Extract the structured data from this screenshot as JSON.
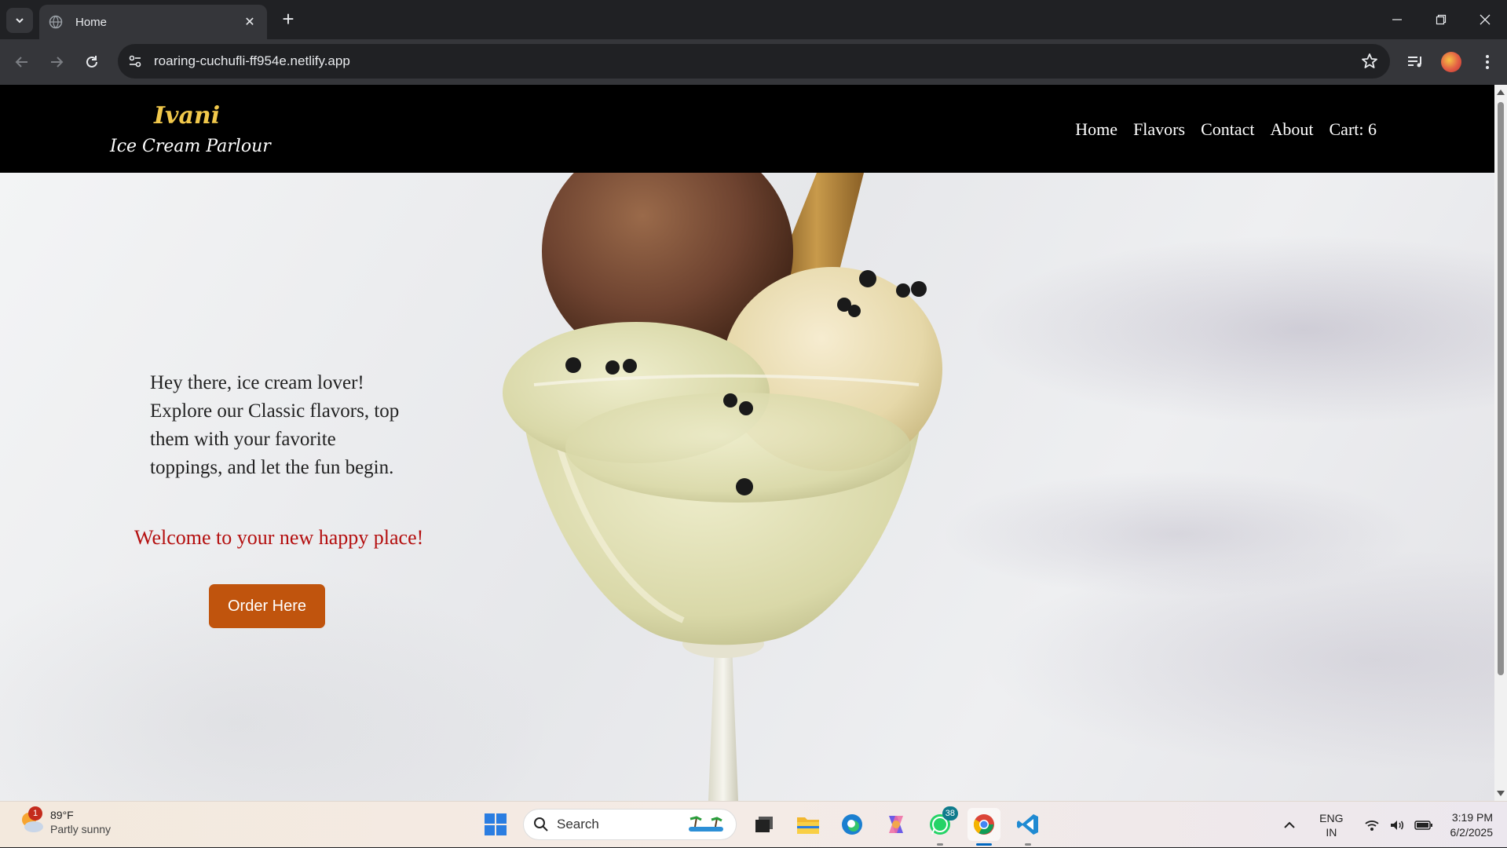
{
  "browser": {
    "tab_title": "Home",
    "url": "roaring-cuchufli-ff954e.netlify.app"
  },
  "site": {
    "logo_name": "Ivani",
    "logo_sub": "Ice Cream Parlour",
    "nav": [
      "Home",
      "Flavors",
      "Contact",
      "About",
      "Cart: 6"
    ]
  },
  "hero": {
    "intro": "Hey there, ice cream lover! Explore our Classic flavors, top them with your favorite toppings, and let the fun begin.",
    "tagline": "Welcome to your new happy place!",
    "cta": "Order Here"
  },
  "taskbar": {
    "weather_badge": "1",
    "temperature": "89°F",
    "condition": "Partly sunny",
    "search_label": "Search",
    "whatsapp_badge": "38",
    "lang_top": "ENG",
    "lang_bottom": "IN",
    "time": "3:19 PM",
    "date": "6/2/2025"
  },
  "colors": {
    "nav_bg": "#000000",
    "logo_accent": "#f1c84b",
    "tagline": "#b40f0f",
    "cta_bg": "#c0540d"
  }
}
